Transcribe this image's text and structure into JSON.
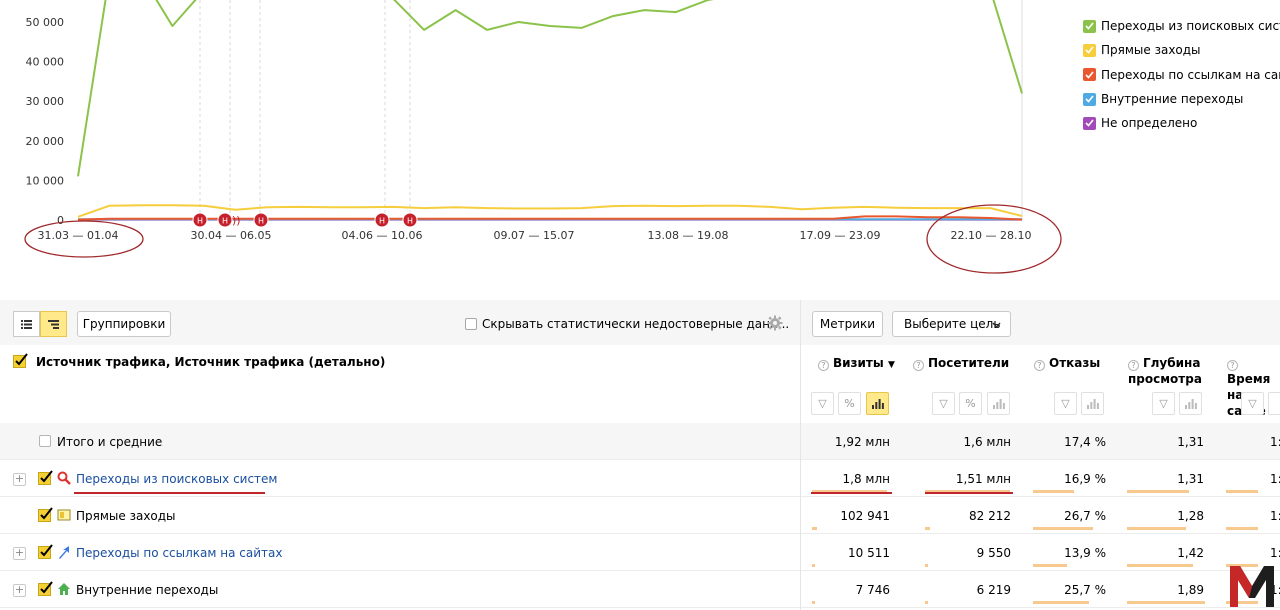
{
  "chart_data": {
    "type": "line",
    "x_tick_labels": [
      "31.03 — 01.04",
      "30.04 — 06.05",
      "04.06 — 10.06",
      "09.07 — 15.07",
      "13.08 — 19.08",
      "17.09 — 23.09",
      "22.10 — 28.10"
    ],
    "y_tick_labels": [
      "50 000",
      "40 000",
      "30 000",
      "20 000",
      "10 000",
      "0"
    ],
    "ylim": [
      0,
      50000
    ],
    "grid": "vertical dashed at annotations",
    "legend_position": "right",
    "series": [
      {
        "name": "Переходы из поисковых систем",
        "color": "#8bc34a",
        "x": [
          0,
          1,
          2,
          3,
          4,
          5,
          6,
          7,
          8,
          9,
          10,
          11,
          12,
          13,
          14,
          15,
          16,
          17,
          18,
          19,
          20,
          21,
          22,
          23,
          24,
          25,
          26,
          27,
          28,
          29,
          30
        ],
        "values": [
          11000,
          62000,
          62000,
          49000,
          58000,
          60000,
          60000,
          62000,
          60000,
          61000,
          56000,
          48000,
          53000,
          48000,
          50000,
          49000,
          48500,
          51500,
          53000,
          52500,
          55500,
          57000,
          58000,
          60000,
          59000,
          58000,
          58500,
          59000,
          60000,
          58000,
          32000
        ]
      },
      {
        "name": "Прямые заходы",
        "color": "#f5cd3d",
        "x": [
          0,
          1,
          2,
          3,
          4,
          5,
          6,
          7,
          8,
          9,
          10,
          11,
          12,
          13,
          14,
          15,
          16,
          17,
          18,
          19,
          20,
          21,
          22,
          23,
          24,
          25,
          26,
          27,
          28,
          29,
          30
        ],
        "values": [
          800,
          3600,
          3700,
          3700,
          3600,
          2600,
          3200,
          3300,
          3200,
          3200,
          3300,
          3000,
          3200,
          3000,
          2900,
          2900,
          3000,
          3500,
          3600,
          3500,
          3600,
          3600,
          3300,
          2700,
          3100,
          3300,
          3100,
          3000,
          3000,
          3000,
          1000
        ]
      },
      {
        "name": "Переходы по ссылкам на сайтах",
        "color": "#e8572e",
        "x": [
          0,
          1,
          2,
          3,
          4,
          5,
          6,
          7,
          8,
          9,
          10,
          11,
          12,
          13,
          14,
          15,
          16,
          17,
          18,
          19,
          20,
          21,
          22,
          23,
          24,
          25,
          26,
          27,
          28,
          29,
          30
        ],
        "values": [
          100,
          300,
          300,
          300,
          300,
          300,
          300,
          300,
          300,
          300,
          300,
          300,
          300,
          300,
          300,
          300,
          300,
          300,
          300,
          300,
          300,
          300,
          300,
          300,
          300,
          900,
          900,
          700,
          700,
          500,
          100
        ]
      },
      {
        "name": "Внутренние переходы",
        "color": "#4eaae0",
        "x": [
          0,
          30
        ],
        "values": [
          200,
          200
        ]
      },
      {
        "name": "Не определено",
        "color": "#a24ab8",
        "x": [
          0,
          30
        ],
        "values": [
          100,
          100
        ]
      }
    ],
    "annotations": [
      {
        "label": "H",
        "x": 4.0
      },
      {
        "label": "H",
        "x": 5.0
      },
      {
        "label": "H",
        "x": 6.0
      },
      {
        "label": "H",
        "x": 10.0
      },
      {
        "label": "H",
        "x": 11.0
      }
    ]
  },
  "legend": [
    {
      "label": "Переходы из поисковых систем",
      "color": "#8bc34a"
    },
    {
      "label": "Прямые заходы",
      "color": "#f5cd3d"
    },
    {
      "label": "Переходы по ссылкам на сайтах",
      "color": "#e8572e"
    },
    {
      "label": "Внутренние переходы",
      "color": "#4eaae0"
    },
    {
      "label": "Не определено",
      "color": "#a24ab8"
    }
  ],
  "toolbar": {
    "groupings_label": "Группировки",
    "hide_unreliable_label": "Скрывать статистически недостоверные данн...",
    "metrics_label": "Метрики",
    "goal_select_label": "Выберите цель"
  },
  "table": {
    "dimension_header": "Источник трафика, Источник трафика (детально)",
    "columns": [
      {
        "label": "Визиты",
        "sort": "▼"
      },
      {
        "label": "Посетители"
      },
      {
        "label": "Отказы"
      },
      {
        "label_line1": "Глубина",
        "label_line2": "просмотра"
      },
      {
        "label_line1": "Время",
        "label_line2": "на сайте"
      }
    ],
    "total": {
      "label": "Итого и средние",
      "visits": "1,92 млн",
      "visitors": "1,6 млн",
      "bounce": "17,4 %",
      "depth": "1,31",
      "time": "1:"
    },
    "rows": [
      {
        "label": "Переходы из поисковых систем",
        "visits": "1,8 млн",
        "visitors": "1,51 млн",
        "bounce": "16,9 %",
        "depth": "1,31",
        "time": "1:",
        "bar_visits": 0.94,
        "bar_visitors": 0.94,
        "bar_bounce": 0.55,
        "bar_depth": 0.8,
        "icon": "search-icon",
        "color": "#d33"
      },
      {
        "label": "Прямые заходы",
        "visits": "102 941",
        "visitors": "82 212",
        "bounce": "26,7 %",
        "depth": "1,28",
        "time": "1:",
        "bar_visits": 0.06,
        "bar_visitors": 0.06,
        "bar_bounce": 0.8,
        "bar_depth": 0.75,
        "icon": "direct-icon",
        "color": "#eac435"
      },
      {
        "label": "Переходы по ссылкам на сайтах",
        "visits": "10 511",
        "visitors": "9 550",
        "bounce": "13,9 %",
        "depth": "1,42",
        "time": "1:",
        "bar_visits": 0.02,
        "bar_visitors": 0.02,
        "bar_bounce": 0.45,
        "bar_depth": 0.85,
        "icon": "link-arrow-icon",
        "color": "#3b7be0"
      },
      {
        "label": "Внутренние переходы",
        "visits": "7 746",
        "visitors": "6 219",
        "bounce": "25,7 %",
        "depth": "1,89",
        "time": "1:",
        "bar_visits": 0.015,
        "bar_visitors": 0.015,
        "bar_bounce": 0.75,
        "bar_depth": 1.0,
        "icon": "home-icon",
        "color": "#4caf50"
      }
    ]
  },
  "watermark_letter": "M"
}
